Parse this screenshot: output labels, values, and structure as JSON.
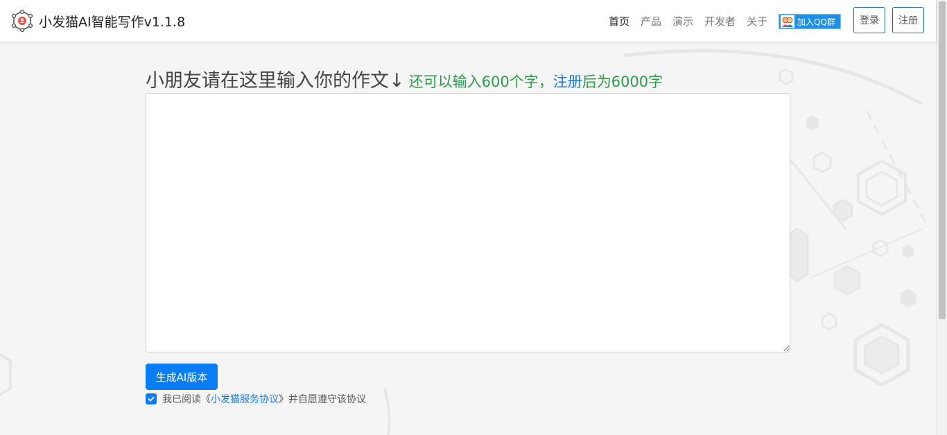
{
  "navbar": {
    "brand_title": "小发猫AI智能写作v1.1.8",
    "links": [
      {
        "label": "首页",
        "active": true
      },
      {
        "label": "产品",
        "active": false
      },
      {
        "label": "演示",
        "active": false
      },
      {
        "label": "开发者",
        "active": false
      },
      {
        "label": "关于",
        "active": false
      }
    ],
    "qq_badge": "加入QQ群",
    "login_label": "登录",
    "register_label": "注册"
  },
  "main": {
    "heading": "小朋友请在这里输入你的作文↓",
    "hint_prefix": "还可以输入600个字，",
    "hint_link": "注册",
    "hint_suffix": "后为6000字",
    "essay_value": "",
    "generate_label": "生成AI版本",
    "agree_prefix": "我已阅读《",
    "agree_link": "小发猫服务协议",
    "agree_suffix": "》并自愿遵守该协议",
    "agree_checked": true
  },
  "colors": {
    "primary": "#0a7cf4",
    "hint_green": "#2e9b48",
    "link_blue": "#1a7be0",
    "navbar_bg": "#ffffff",
    "page_bg": "#f5f5f5"
  }
}
